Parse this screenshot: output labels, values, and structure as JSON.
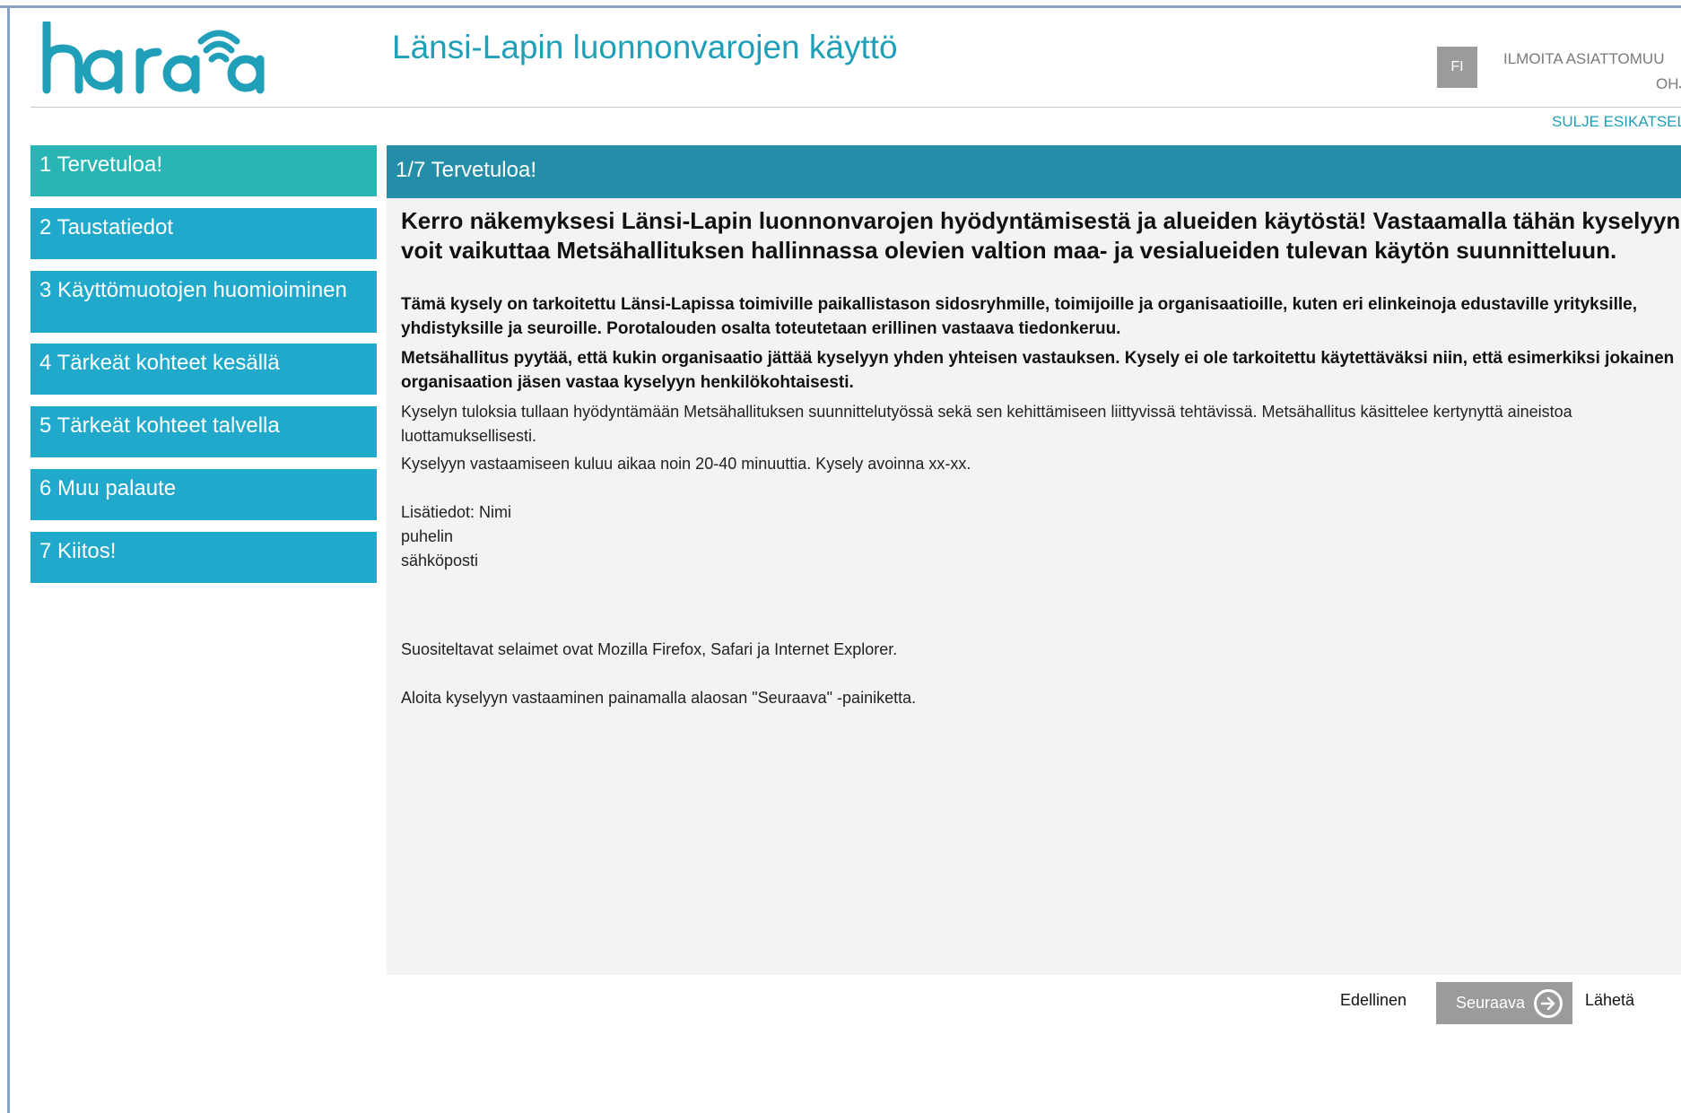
{
  "header": {
    "logo_text": "harava",
    "app_title": "Länsi-Lapin luonnonvarojen käyttö",
    "lang_button": "FI",
    "report_link": "ILMOITA ASIATTOMUU",
    "help_link": "OHJ",
    "close_preview": "SULJE ESIKATSEL"
  },
  "colors": {
    "accent": "#20a9cb",
    "active_nav": "#2ab5b5",
    "panel_header": "#248ea8",
    "title_text": "#1f9fb8"
  },
  "sidebar": {
    "items": [
      {
        "label": "1 Tervetuloa!",
        "active": true
      },
      {
        "label": "2 Taustatiedot",
        "active": false
      },
      {
        "label": "3 Käyttömuotojen huomioiminen",
        "active": false
      },
      {
        "label": "4 Tärkeät kohteet kesällä",
        "active": false
      },
      {
        "label": "5 Tärkeät kohteet talvella",
        "active": false
      },
      {
        "label": "6 Muu palaute",
        "active": false
      },
      {
        "label": "7 Kiitos!",
        "active": false
      }
    ]
  },
  "main": {
    "page_title": "1/7 Tervetuloa!",
    "lead_line1": "Kerro näkemyksesi Länsi-Lapin luonnonvarojen hyödyntämisestä ja alueiden käytöstä! Vastaamalla tähän kyselyyn",
    "lead_line2": "voit vaikuttaa Metsähallituksen hallinnassa olevien valtion maa- ja vesialueiden tulevan käytön suunnitteluun.",
    "bold1": "Tämä kysely on tarkoitettu Länsi-Lapissa toimiville paikallistason sidosryhmille, toimijoille ja organisaatioille, kuten eri elinkeinoja edustaville yrityksille, yhdistyksille ja seuroille. Porotalouden osalta toteutetaan erillinen vastaava tiedonkeruu.",
    "bold2": "Metsähallitus pyytää, että kukin organisaatio jättää kyselyyn yhden yhteisen vastauksen. Kysely ei ole tarkoitettu käytettäväksi niin, että esimerkiksi jokainen organisaation jäsen vastaa kyselyyn henkilökohtaisesti.",
    "p1": "Kyselyn tuloksia tullaan hyödyntämään Metsähallituksen suunnittelutyössä sekä sen kehittämiseen liittyvissä tehtävissä. Metsähallitus käsittelee kertynyttä aineistoa luottamuksellisesti.",
    "p2": "Kyselyyn vastaamiseen kuluu aikaa noin 20-40 minuuttia. Kysely avoinna xx-xx.",
    "contact_name": "Lisätiedot: Nimi",
    "contact_phone": "puhelin",
    "contact_email": "sähköposti",
    "browsers": "Suositeltavat selaimet ovat Mozilla Firefox, Safari ja Internet Explorer.",
    "start": "Aloita kyselyyn vastaaminen painamalla alaosan \"Seuraava\" -painiketta."
  },
  "footer": {
    "prev_label": "Edellinen",
    "next_label": "Seuraava",
    "next_icon": "arrow-right-circle-icon",
    "send_label": "Lähetä"
  }
}
